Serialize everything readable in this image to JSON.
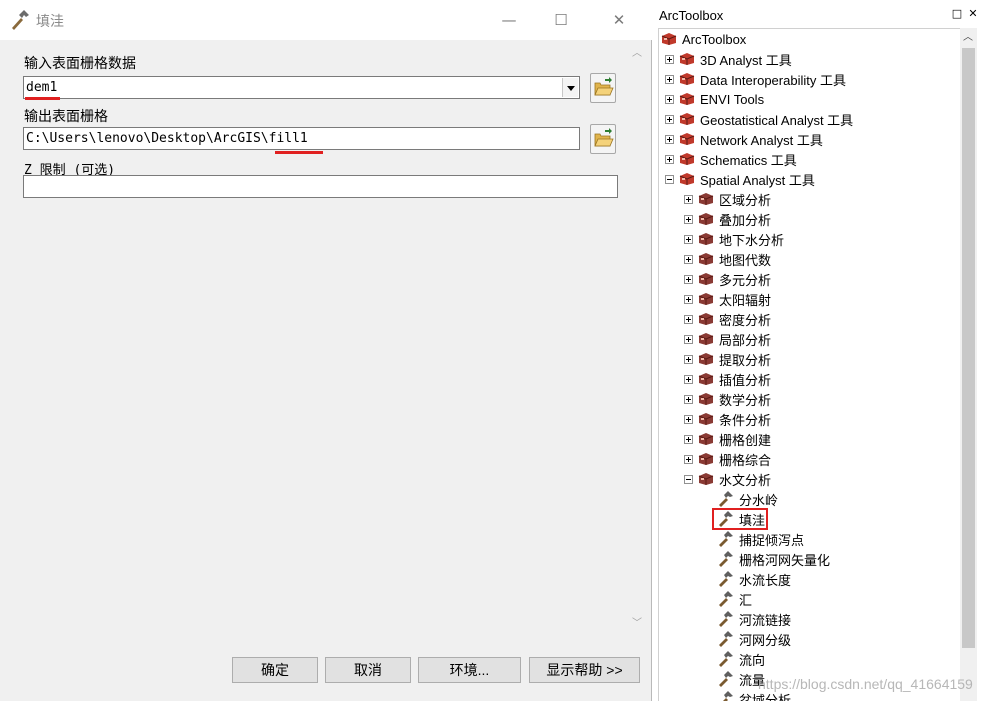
{
  "dialog": {
    "title": "填洼",
    "window_controls": {
      "minimize": "—",
      "maximize": "☐",
      "close": "✕"
    },
    "input_raster": {
      "label": "输入表面栅格数据",
      "value": "dem1"
    },
    "output_raster": {
      "label": "输出表面栅格",
      "value": "C:\\Users\\lenovo\\Desktop\\ArcGIS\\fill1"
    },
    "z_limit": {
      "label": "Z 限制 (可选)",
      "value": ""
    },
    "buttons": {
      "ok": "确定",
      "cancel": "取消",
      "environments": "环境...",
      "show_help": "显示帮助 >>"
    }
  },
  "toolbox": {
    "panel_title": "ArcToolbox",
    "header_buttons": {
      "restore": "□",
      "close": "✕"
    },
    "root_label": "ArcToolbox",
    "toolboxes": [
      "3D Analyst 工具",
      "Data Interoperability 工具",
      "ENVI Tools",
      "Geostatistical Analyst 工具",
      "Network Analyst 工具",
      "Schematics 工具",
      "Spatial Analyst 工具"
    ],
    "spatial_analyst_toolsets": [
      "区域分析",
      "叠加分析",
      "地下水分析",
      "地图代数",
      "多元分析",
      "太阳辐射",
      "密度分析",
      "局部分析",
      "提取分析",
      "插值分析",
      "数学分析",
      "条件分析",
      "栅格创建",
      "栅格综合",
      "水文分析"
    ],
    "hydrology_tools": [
      "分水岭",
      "填洼",
      "捕捉倾泻点",
      "栅格河网矢量化",
      "水流长度",
      "汇",
      "河流链接",
      "河网分级",
      "流向",
      "流量",
      "盆域分析"
    ],
    "selected_tool": "填洼"
  },
  "watermark": "https://blog.csdn.net/qq_41664159",
  "colors": {
    "highlight_red": "#e02020",
    "toolbox_red": "#c0392b"
  }
}
